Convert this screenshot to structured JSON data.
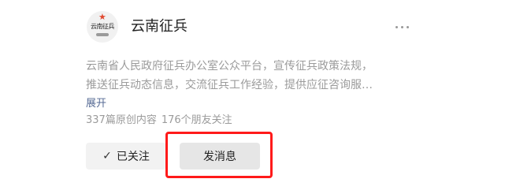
{
  "account": {
    "name": "云南征兵",
    "avatar": {
      "logo_text": "云南征兵",
      "star": "★"
    },
    "more_label": "…"
  },
  "profile": {
    "description_lines": [
      "云南省人民政府征兵办公室公众平台，宣传征兵政策法规，",
      "推送征兵动态信息，交流征兵工作经验，提供应征咨询服…"
    ],
    "expand_label": "展开",
    "original_count": "337篇原创内容",
    "friends_following": "176个朋友关注"
  },
  "actions": {
    "followed_check": "✓",
    "followed_label": "已关注",
    "message_label": "发消息"
  },
  "annotation": {
    "highlight_color": "#ff1a1a",
    "highlight_target": "message-button"
  },
  "colors": {
    "link": "#576b95",
    "muted_text": "#9b9b9b",
    "button_bg": "#f2f2f2"
  }
}
